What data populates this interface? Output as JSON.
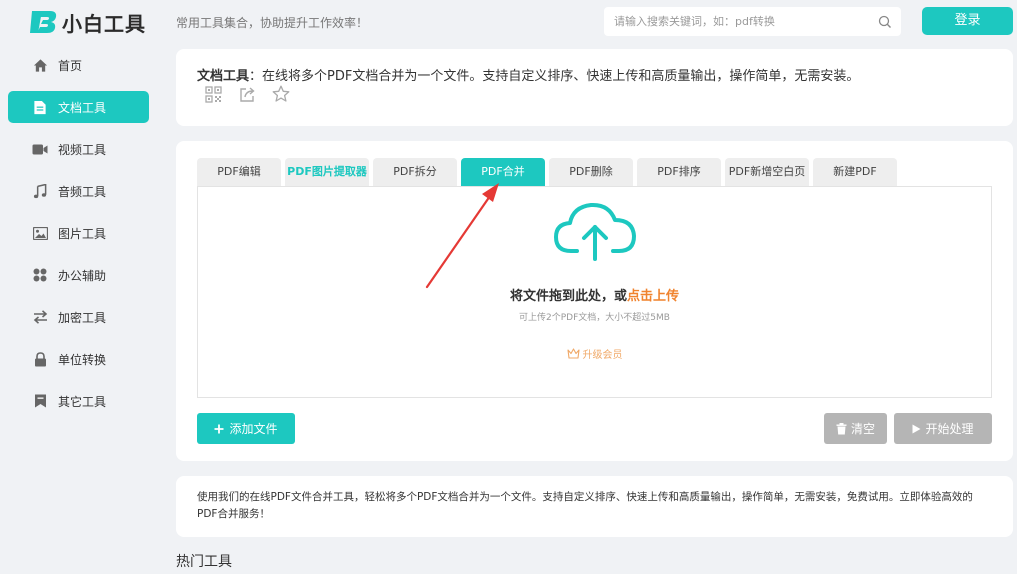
{
  "header": {
    "brand": "小白工具",
    "slogan": "常用工具集合，协助提升工作效率！",
    "search_placeholder": "请输入搜索关键词，如：pdf转换",
    "login_label": "登录"
  },
  "sidebar": {
    "items": [
      {
        "label": "首页",
        "icon": "home-icon"
      },
      {
        "label": "文档工具",
        "icon": "document-icon",
        "active": true
      },
      {
        "label": "视频工具",
        "icon": "video-icon"
      },
      {
        "label": "音频工具",
        "icon": "music-icon"
      },
      {
        "label": "图片工具",
        "icon": "image-icon"
      },
      {
        "label": "办公辅助",
        "icon": "apps-icon"
      },
      {
        "label": "加密工具",
        "icon": "swap-icon"
      },
      {
        "label": "单位转换",
        "icon": "lock-icon"
      },
      {
        "label": "其它工具",
        "icon": "bookmark-icon"
      }
    ]
  },
  "doc": {
    "title_bold": "文档工具",
    "title_rest": "：在线将多个PDF文档合并为一个文件。支持自定义排序、快速上传和高质量输出，操作简单，无需安装。"
  },
  "tabs": [
    {
      "label": "PDF编辑"
    },
    {
      "label": "PDF图片提取器",
      "highlight": true
    },
    {
      "label": "PDF拆分"
    },
    {
      "label": "PDF合并",
      "active": true
    },
    {
      "label": "PDF删除"
    },
    {
      "label": "PDF排序"
    },
    {
      "label": "PDF新增空白页"
    },
    {
      "label": "新建PDF"
    }
  ],
  "upload": {
    "drop_text": "将文件拖到此处，或",
    "click_upload": "点击上传",
    "limit_text": "可上传2个PDF文档，大小不超过5MB",
    "vip_label": "升级会员"
  },
  "buttons": {
    "add_file": "添加文件",
    "clear": "清空",
    "start": "开始处理"
  },
  "description": "使用我们的在线PDF文件合并工具，轻松将多个PDF文档合并为一个文件。支持自定义排序、快速上传和高质量输出，操作简单，无需安装，免费试用。立即体验高效的PDF合并服务！",
  "hot_tools_title": "热门工具",
  "colors": {
    "accent": "#1dc8c0",
    "orange": "#f0832e",
    "disabled": "#b5b5b5",
    "arrow": "#e53935"
  }
}
